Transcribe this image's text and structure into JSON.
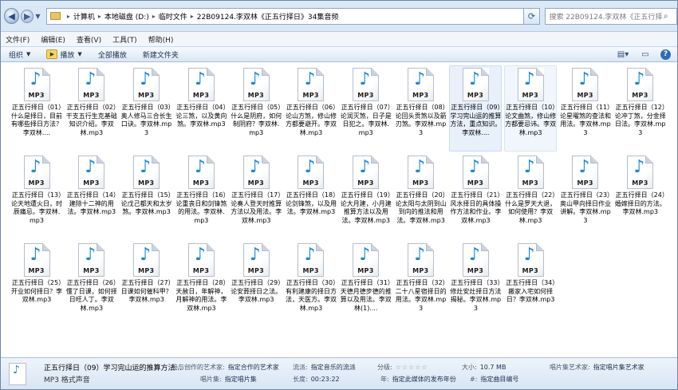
{
  "address": {
    "crumbs": [
      "计算机",
      "本地磁盘 (D:)",
      "临时文件",
      "22B09124.李双林《正五行择日》34集音频"
    ],
    "search_placeholder": "搜索 22B09124.李双林《正五行择日..."
  },
  "menu": [
    "文件(F)",
    "编辑(E)",
    "查看(V)",
    "工具(T)",
    "帮助(H)"
  ],
  "toolbar": {
    "organize": "组织",
    "play": "播放",
    "play_all": "全部播放",
    "new_folder": "新建文件夹"
  },
  "files": [
    "正五行择日（01）什么是择日，目前有哪些择日方法？李双林....",
    "正五行择日（02）干支五行生克基础知识介绍。李双林.mp3",
    "正五行择日（03）奥人修马三合长生口诀。李双林.mp3",
    "正五行择日（04）论三煞，以及黄向煞。李双林.mp3",
    "正五行择日（05）什么是阴府，如何制阴府？李双林.mp3",
    "正五行择日（06）论山方煞，修山修方都要避开。李双林.mp3",
    "正五行择日（07）论润灭煞，日子是日犯之。李双林.mp3",
    "正五行择日（08）论回头贡煞以及箭刃煞。李双林.mp3",
    "正五行择日（09）学习完山运的推算方法，重点知识。李双林....",
    "正五行择日（10）论文曲煞，修山修方都要忌讳。李双林.mp3",
    "正五行择日（11）论星曜煞的查法和用法。李双林.mp3",
    "正五行择日（12）论冲丁煞，分金择日法。李双林.mp3",
    "正五行择日（13）论天地遭火日，时辰痛忌。李双林.mp3",
    "正五行择日（14）建除十二神的用法。李双林.mp3",
    "正五行择日（15）论戊己都天和太岁煞。李双林.mp3",
    "正五行择日（16）论重丧日和剑锋煞的用法。李双林.mp3",
    "正五行择日（17）论奏人登天时推算方法以及用法。李双林.mp3",
    "正五行择日（18）论剑锋煞，以及用法。李双林.mp3",
    "正五行择日（19）论大月建，小月建推算方法以及用法。李双林.mp3",
    "正五行择日（20）论太阳与太阴到山到向的推法和用法。李双林.mp3",
    "正五行择日（21）风水择日的具体操作方法和作业。李双林.mp3",
    "正五行择日（22）什么是罗天大退，如何使用？李双林.mp3",
    "正五行择日（23）奥山甲向择日作业讲解。李双林.mp3",
    "正五行择日（24）婚嫁择日的方法。李双林.mp3",
    "正五行择日（25）开业如何择日？李双林.mp3",
    "正五行择日（26）懂了日课，如何择日旺人丁。李双林.mp3",
    "正五行择日（27）日课如何催科甲？李双林.mp3",
    "正五行择日（28）天赦日，年解神，月解神的用法。李双林.mp3",
    "正五行择日（29）论安葬择日之法。李双林.mp3",
    "正五行择日（30）有利建康的择日方法，天医方。李双林.mp3",
    "正五行择日（31）天德月德步德的推算以及用法。李双林(1)....",
    "正五行择日（32）二十八星宿择日的用法。李双林.mp3",
    "正五行择日（33）修灶安灶择日方法揭秘。李双林.mp3",
    "正五行择日（34）搬家入宅如何择日？李双林.mp3"
  ],
  "file_type_label": "MP3",
  "selected_index": 8,
  "hover_index": 9,
  "details": {
    "title": "正五行择日（09）学习完山运的推算方法...",
    "type": "MP3 格式声音",
    "fields": [
      {
        "k": "参与创作的艺术家:",
        "v": "指定合作的艺术家"
      },
      {
        "k": "唱片集:",
        "v": "指定唱片集"
      },
      {
        "k": "流派:",
        "v": "指定音乐的流派"
      },
      {
        "k": "长度:",
        "v": "00:23:22"
      },
      {
        "k": "分级:",
        "v": ""
      },
      {
        "k": "年:",
        "v": "指定此媒体的发布年份"
      },
      {
        "k": "大小:",
        "v": "10.7 MB"
      },
      {
        "k": "#:",
        "v": "指定曲目编号"
      },
      {
        "k": "唱片集艺术家:",
        "v": "指定唱片集艺术家"
      }
    ]
  }
}
